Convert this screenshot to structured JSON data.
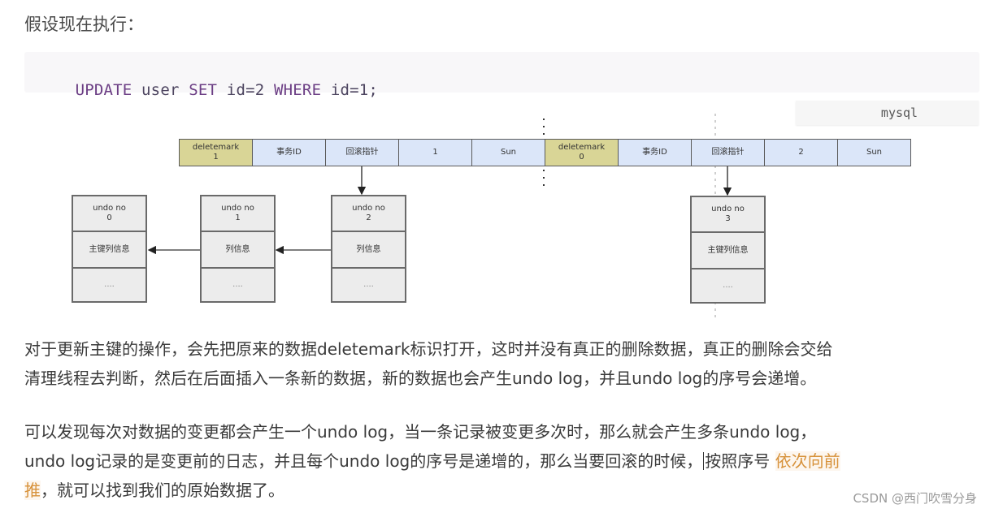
{
  "heading": "假设现在执行：",
  "code": {
    "tokens": [
      {
        "text": "UPDATE",
        "kind": "keyword"
      },
      {
        "text": " user ",
        "kind": "plain"
      },
      {
        "text": "SET",
        "kind": "keyword"
      },
      {
        "text": " id=2 ",
        "kind": "plain"
      },
      {
        "text": "WHERE",
        "kind": "keyword"
      },
      {
        "text": " id=1;",
        "kind": "plain"
      }
    ],
    "language": "mysql"
  },
  "diagram": {
    "old_row": {
      "cells": [
        "deletemark\n1",
        "事务ID",
        "回滚指针",
        "1",
        "Sun"
      ]
    },
    "new_row": {
      "cells": [
        "deletemark\n0",
        "事务ID",
        "回滚指针",
        "2",
        "Sun"
      ]
    },
    "undo_logs": [
      {
        "title": "undo no\n0",
        "info": "主键列信息",
        "more": "...."
      },
      {
        "title": "undo no\n1",
        "info": "列信息",
        "more": "...."
      },
      {
        "title": "undo no\n2",
        "info": "列信息",
        "more": "...."
      },
      {
        "title": "undo no\n3",
        "info": "主键列信息",
        "more": "...."
      }
    ],
    "colors": {
      "deletemark_cell": "#d9d596",
      "field_cell": "#dbe6f9",
      "undo_box": "#ececec"
    }
  },
  "paragraphs": {
    "p1_line1": "对于更新主键的操作，会先把原来的数据deletemark标识打开，这时并没有真正的删除数据，真正的删除会交给",
    "p1_line2": "清理线程去判断，然后在后面插入一条新的数据，新的数据也会产生undo log，并且undo log的序号会递增。",
    "p2_line1": "可以发现每次对数据的变更都会产生一个undo log，当一条记录被变更多次时，那么就会产生多条undo log，",
    "p2_line2_before": "undo log记录的是变更前的日志，并且每个undo log的序号是递增的，那么当要回滚的时候，",
    "p2_line2_after": "按照序号 ",
    "p2_highlight_1": "依次向前",
    "p2_highlight_2": "推",
    "p2_line3_rest": "，就可以找到我们的原始数据了。"
  },
  "highlight_color": "#d7923b",
  "watermark": "CSDN @西门吹雪分身"
}
